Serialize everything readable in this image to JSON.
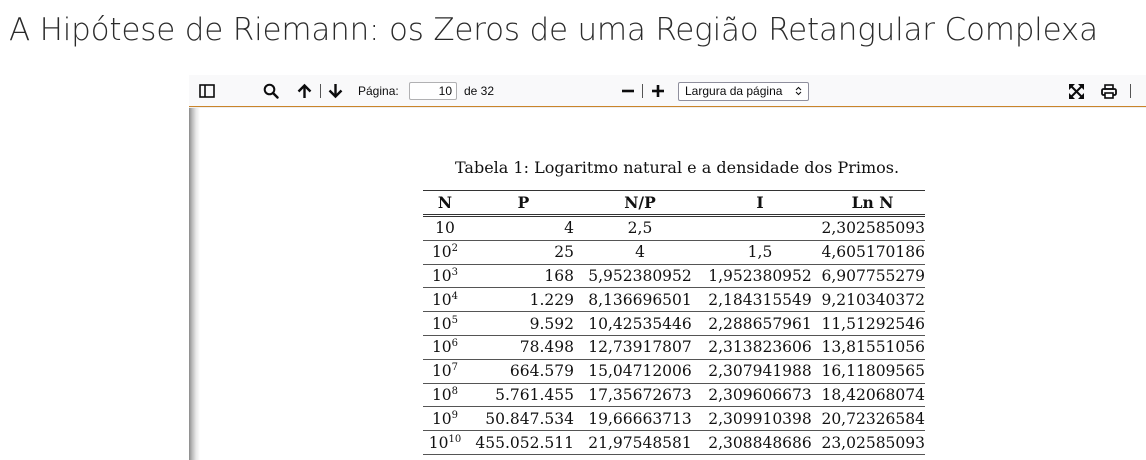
{
  "page": {
    "heading": "A Hipótese de Riemann: os Zeros de uma Região Retangular Complexa"
  },
  "toolbar": {
    "page_label": "Página:",
    "page_value": "10",
    "page_total": "de 32",
    "zoom_value": "Largura da página",
    "icons": [
      "sidebar-toggle-icon",
      "search-icon",
      "arrow-up-icon",
      "arrow-down-icon",
      "minus-icon",
      "plus-icon",
      "fullscreen-icon",
      "print-icon"
    ]
  },
  "document": {
    "caption": "Tabela 1: Logaritmo natural e a densidade dos Primos.",
    "table": {
      "headers": [
        "N",
        "P",
        "N/P",
        "I",
        "Ln N"
      ],
      "rows": [
        {
          "n_base": "10",
          "n_exp": "",
          "p": "4",
          "np": "2,5",
          "i": "",
          "ln": "2,302585093"
        },
        {
          "n_base": "10",
          "n_exp": "2",
          "p": "25",
          "np": "4",
          "i": "1,5",
          "ln": "4,605170186"
        },
        {
          "n_base": "10",
          "n_exp": "3",
          "p": "168",
          "np": "5,952380952",
          "i": "1,952380952",
          "ln": "6,907755279"
        },
        {
          "n_base": "10",
          "n_exp": "4",
          "p": "1.229",
          "np": "8,136696501",
          "i": "2,184315549",
          "ln": "9,210340372"
        },
        {
          "n_base": "10",
          "n_exp": "5",
          "p": "9.592",
          "np": "10,42535446",
          "i": "2,288657961",
          "ln": "11,51292546"
        },
        {
          "n_base": "10",
          "n_exp": "6",
          "p": "78.498",
          "np": "12,73917807",
          "i": "2,313823606",
          "ln": "13,81551056"
        },
        {
          "n_base": "10",
          "n_exp": "7",
          "p": "664.579",
          "np": "15,04712006",
          "i": "2,307941988",
          "ln": "16,11809565"
        },
        {
          "n_base": "10",
          "n_exp": "8",
          "p": "5.761.455",
          "np": "17,35672673",
          "i": "2,309606673",
          "ln": "18,42068074"
        },
        {
          "n_base": "10",
          "n_exp": "9",
          "p": "50.847.534",
          "np": "19,66663713",
          "i": "2,309910398",
          "ln": "20,72326584"
        },
        {
          "n_base": "10",
          "n_exp": "10",
          "p": "455.052.511",
          "np": "21,97548581",
          "i": "2,308848686",
          "ln": "23,02585093"
        }
      ]
    }
  },
  "colors": {
    "toolbar_bg": "#f9f9fa",
    "toolbar_border": "#c9842a",
    "text": "#0c0c0d"
  }
}
